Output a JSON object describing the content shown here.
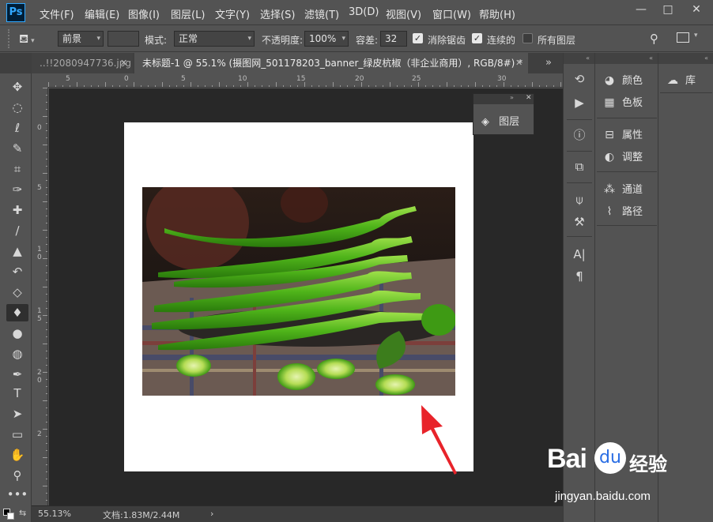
{
  "app": {
    "logo": "Ps"
  },
  "menu": {
    "items": [
      "文件(F)",
      "编辑(E)",
      "图像(I)",
      "图层(L)",
      "文字(Y)",
      "选择(S)",
      "滤镜(T)",
      "3D(D)",
      "视图(V)",
      "窗口(W)",
      "帮助(H)"
    ]
  },
  "window_controls": {
    "minimize": "—",
    "maximize": "□",
    "close": "✕"
  },
  "options": {
    "fill_source": "前景",
    "mode_label": "模式:",
    "mode_value": "正常",
    "opacity_label": "不透明度:",
    "opacity_value": "100%",
    "tolerance_label": "容差:",
    "tolerance_value": "32",
    "antialias_label": "消除锯齿",
    "antialias_checked": true,
    "contiguous_label": "连续的",
    "contiguous_checked": true,
    "all_layers_label": "所有图层",
    "all_layers_checked": false
  },
  "tabs": [
    {
      "label": "..!!2080947736.jpg",
      "active": false
    },
    {
      "label": "未标题-1 @ 55.1% (摄图网_501178203_banner_绿皮杭椒（非企业商用）, RGB/8#) *",
      "active": true
    }
  ],
  "tab_overflow": "»",
  "tools": [
    "move-icon",
    "marquee-icon",
    "lasso-icon",
    "quick-select-icon",
    "crop-icon",
    "eyedropper-icon",
    "healing-icon",
    "brush-icon",
    "stamp-icon",
    "history-brush-icon",
    "eraser-icon",
    "paint-bucket-icon",
    "blur-icon",
    "dodge-icon",
    "pen-icon",
    "type-icon",
    "path-select-icon",
    "rectangle-icon",
    "hand-icon",
    "zoom-icon",
    "more-icon"
  ],
  "tool_glyphs": [
    "✥",
    "◌",
    "ℓ",
    "✎",
    "⌗",
    "✑",
    "✚",
    "∕",
    "▲",
    "↶",
    "◇",
    "♦",
    "●",
    "◍",
    "✒",
    "T",
    "➤",
    "▭",
    "✋",
    "⚲",
    "•••"
  ],
  "ruler": {
    "top_labels": [
      "5",
      "0",
      "5",
      "10",
      "15",
      "20",
      "25",
      "30"
    ],
    "left_labels": [
      "0",
      "5",
      "1",
      "0",
      "1",
      "5",
      "2",
      "0",
      "2"
    ]
  },
  "float_panel": {
    "layers_label": "图层"
  },
  "status": {
    "zoom": "55.13%",
    "doc_info": "文档:1.83M/2.44M",
    "arrow": "›"
  },
  "dock": {
    "group1": [
      {
        "name": "颜色",
        "icon": "color-icon"
      },
      {
        "name": "色板",
        "icon": "swatches-icon"
      }
    ],
    "group2": [
      {
        "name": "属性",
        "icon": "properties-icon"
      },
      {
        "name": "调整",
        "icon": "adjustments-icon"
      }
    ],
    "group3": [
      {
        "name": "通道",
        "icon": "channels-icon"
      },
      {
        "name": "路径",
        "icon": "paths-icon"
      }
    ],
    "library": {
      "name": "库",
      "icon": "cc-libraries-icon"
    }
  },
  "watermark": {
    "brand": "Bai",
    "brand_suffix": "经验",
    "url": "jingyan.baidu.com"
  },
  "colors": {
    "accent_blue": "#31a8ff",
    "annotation_red": "#e8232a",
    "canvas_bg": "#282828"
  }
}
